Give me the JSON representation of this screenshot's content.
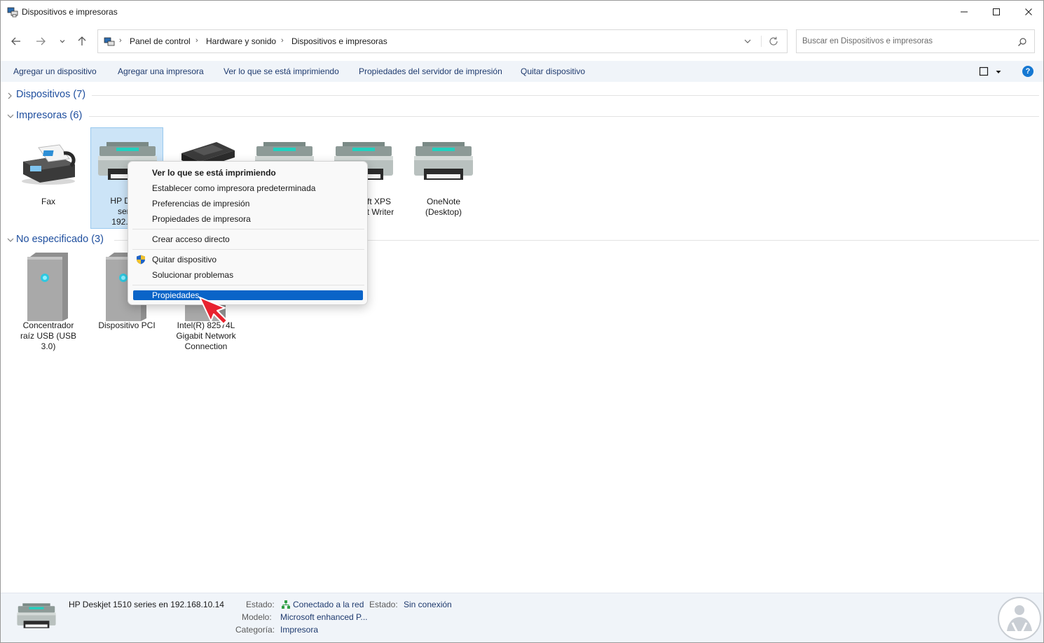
{
  "window": {
    "title": "Dispositivos e impresoras"
  },
  "address": {
    "crumbs": [
      "Panel de control",
      "Hardware y sonido",
      "Dispositivos e impresoras"
    ],
    "search_placeholder": "Buscar en Dispositivos e impresoras"
  },
  "commands": {
    "add_device": "Agregar un dispositivo",
    "add_printer": "Agregar una impresora",
    "see_printing": "Ver lo que se está imprimiendo",
    "server_props": "Propiedades del servidor de impresión",
    "remove_device": "Quitar dispositivo",
    "help": "?"
  },
  "groups": {
    "devices": "Dispositivos (7)",
    "printers": "Impresoras (6)",
    "unspecified": "No especificado (3)"
  },
  "printers": [
    {
      "line1": "Fax",
      "line2": "",
      "line3": ""
    },
    {
      "line1": "HP Desk",
      "line2": "serie",
      "line3": "192.168"
    },
    {
      "line1": "",
      "line2": "",
      "line3": ""
    },
    {
      "line1": "",
      "line2": "",
      "line3": ""
    },
    {
      "line1": "ft XPS",
      "line2": "t Writer",
      "line3": ""
    },
    {
      "line1": "OneNote",
      "line2": "(Desktop)",
      "line3": ""
    }
  ],
  "unspecified": [
    {
      "line1": "Concentrador",
      "line2": "raíz USB (USB 3.0)",
      "line3": ""
    },
    {
      "line1": "Dispositivo PCI",
      "line2": "",
      "line3": ""
    },
    {
      "line1": "Intel(R) 82574L",
      "line2": "Gigabit Network",
      "line3": "Connection"
    }
  ],
  "context_menu": {
    "see_printing": "Ver lo que se está imprimiendo",
    "set_default": "Establecer como impresora predeterminada",
    "print_prefs": "Preferencias de impresión",
    "printer_props": "Propiedades de impresora",
    "create_shortcut": "Crear acceso directo",
    "remove_device": "Quitar dispositivo",
    "troubleshoot": "Solucionar problemas",
    "properties": "Propiedades"
  },
  "details": {
    "device_name": "HP Deskjet 1510 series en 192.168.10.14",
    "status_label": "Estado:",
    "status_value": "Conectado a la red",
    "status2_label": "Estado:",
    "status2_value": "Sin conexión",
    "model_label": "Modelo:",
    "model_value": "Microsoft enhanced P...",
    "category_label": "Categoría:",
    "category_value": "Impresora"
  },
  "colors": {
    "accent": "#0a64c8",
    "link": "#1e4e9e",
    "selection": "#cce4f7",
    "command_bar": "#f0f4f9"
  }
}
